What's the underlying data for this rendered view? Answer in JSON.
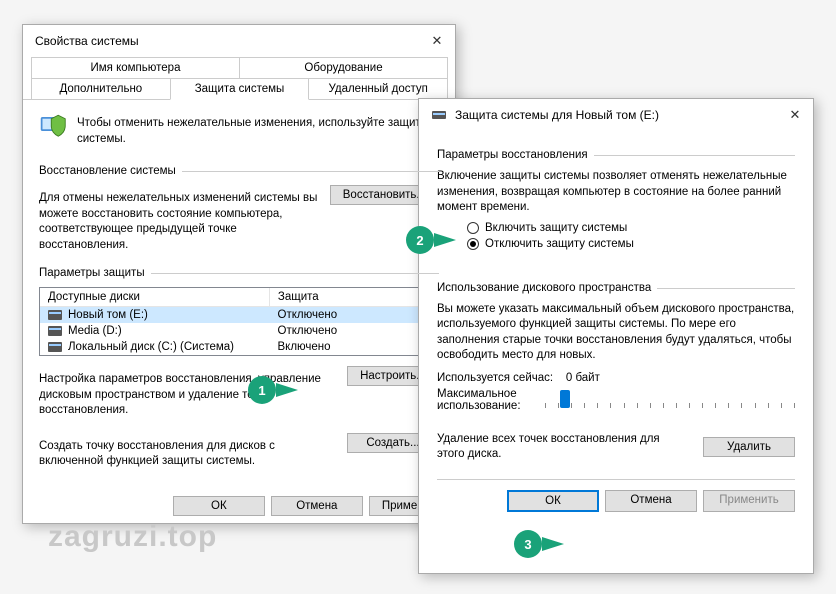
{
  "window1": {
    "title": "Свойства системы",
    "tabs": {
      "computer_name": "Имя компьютера",
      "hardware": "Оборудование",
      "advanced": "Дополнительно",
      "system_protection": "Защита системы",
      "remote": "Удаленный доступ"
    },
    "info_text": "Чтобы отменить нежелательные изменения, используйте защиту системы.",
    "restore_group": "Восстановление системы",
    "restore_desc": "Для отмены нежелательных изменений системы вы можете восстановить состояние компьютера, соответствующее предыдущей точке восстановления.",
    "restore_btn": "Восстановить...",
    "params_group": "Параметры защиты",
    "table": {
      "col_drives": "Доступные диски",
      "col_protection": "Защита",
      "rows": [
        {
          "name": "Новый том (E:)",
          "status": "Отключено",
          "selected": true
        },
        {
          "name": "Media (D:)",
          "status": "Отключено",
          "selected": false
        },
        {
          "name": "Локальный диск (C:) (Система)",
          "status": "Включено",
          "selected": false
        }
      ]
    },
    "configure_desc": "Настройка параметров восстановления, управление дисковым пространством и удаление точек восстановления.",
    "configure_btn": "Настроить...",
    "create_desc": "Создать точку восстановления для дисков с включенной функцией защиты системы.",
    "create_btn": "Создать...",
    "footer": {
      "ok": "ОК",
      "cancel": "Отмена",
      "apply": "Примени"
    }
  },
  "window2": {
    "title": "Защита системы для Новый том (E:)",
    "restore_params": "Параметры восстановления",
    "restore_desc": "Включение защиты системы позволяет отменять нежелательные изменения, возвращая компьютер в состояние на более ранний момент времени.",
    "radio_enable": "Включить защиту системы",
    "radio_disable": "Отключить защиту системы",
    "radio_selected": "disable",
    "disk_usage_group": "Использование дискового пространства",
    "disk_usage_desc": "Вы можете указать максимальный объем дискового пространства, используемого функцией защиты системы. По мере его заполнения старые точки восстановления будут удаляться, чтобы освободить место для новых.",
    "usage_now_label": "Используется сейчас:",
    "usage_now_value": "0 байт",
    "max_usage_label": "Максимальное использование:",
    "delete_desc": "Удаление всех точек восстановления для этого диска.",
    "delete_btn": "Удалить",
    "footer": {
      "ok": "ОК",
      "cancel": "Отмена",
      "apply": "Применить"
    }
  },
  "callouts": {
    "one": "1",
    "two": "2",
    "three": "3"
  },
  "watermark": "zagruzi.top"
}
